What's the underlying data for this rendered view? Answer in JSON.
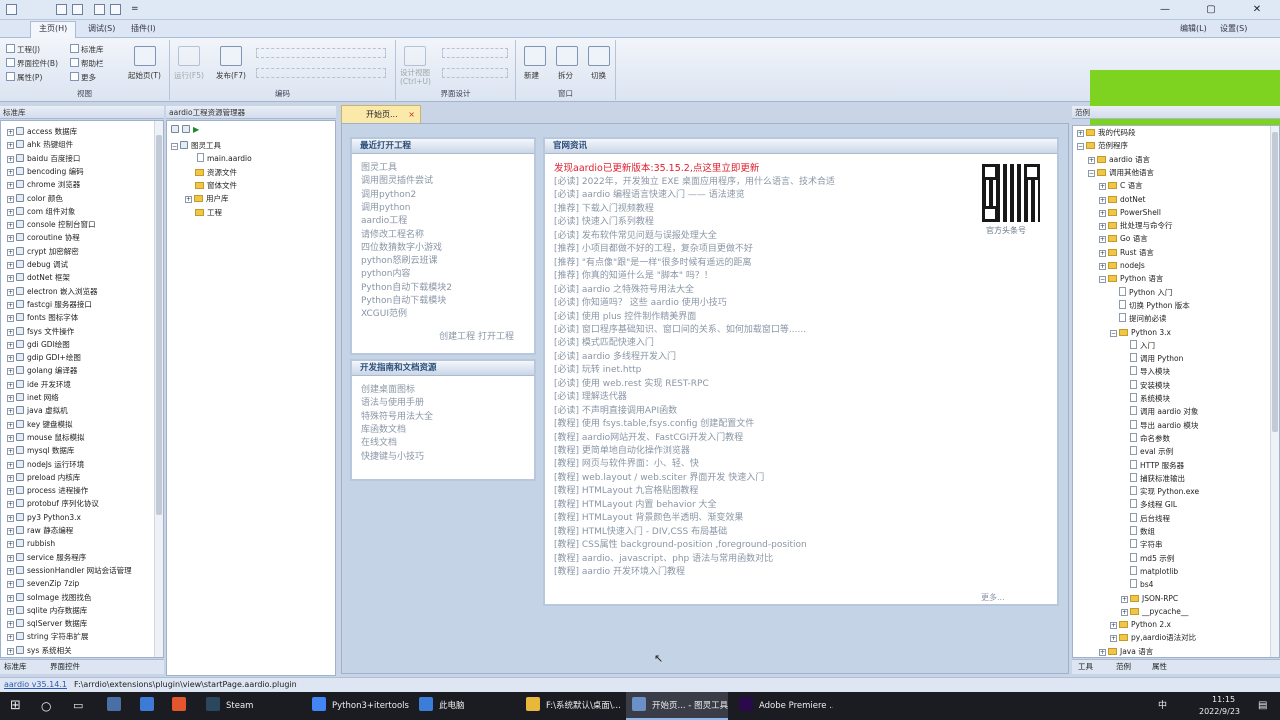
{
  "app": {
    "menu_tabs": [
      "主页(H)",
      "调试(S)",
      "插件(I)"
    ],
    "right_menu": [
      "编辑(L)",
      "设置(S)"
    ],
    "title_hint": "="
  },
  "ribbon": {
    "view_group": {
      "label": "视图",
      "items": [
        "工程(J)",
        "界面控件(B)",
        "属性(P)",
        "标准库",
        "帮助栏",
        "更多"
      ],
      "start_page": "起始页(T)"
    },
    "code_group": {
      "label": "编码",
      "run": "运行(F5)",
      "publish": "发布(F7)"
    },
    "ui_group": {
      "label": "界面设计",
      "design_view": "设计视图\n(Ctrl+U)"
    },
    "window_group": {
      "label": "窗口",
      "new": "新建",
      "split": "拆分",
      "switch": "切换"
    }
  },
  "left_panel": {
    "title": "标准库",
    "items": [
      "access 数据库",
      "ahk 热键组件",
      "baidu 百度接口",
      "bencoding 编码",
      "chrome 浏览器",
      "color 颜色",
      "com 组件对象",
      "console 控制台窗口",
      "coroutine 协程",
      "crypt 加密解密",
      "debug 调试",
      "dotNet 框架",
      "electron 嵌入浏览器",
      "fastcgi 服务器接口",
      "fonts 图标字体",
      "fsys 文件操作",
      "gdi GDI绘图",
      "gdip GDI+绘图",
      "golang 编译器",
      "ide 开发环境",
      "inet 网络",
      "java 虚拟机",
      "key 键盘模拟",
      "mouse 鼠标模拟",
      "mysql 数据库",
      "nodeJs 运行环境",
      "preload 内核库",
      "process 进程操作",
      "protobuf 序列化协议",
      "py3 Python3.x",
      "raw 静态编程",
      "rubbish",
      "service 服务程序",
      "sessionHandler 网站会话管理",
      "sevenZip 7zip",
      "soImage 找图找色",
      "sqlite 内存数据库",
      "sqlServer 数据库",
      "string 字符串扩展",
      "sys 系统相关"
    ],
    "bottom_tabs": [
      "标准库",
      "界面控件"
    ]
  },
  "project_panel": {
    "title": "aardio工程资源管理器",
    "items": [
      {
        "label": "图灵工具",
        "type": "root"
      },
      {
        "label": "main.aardio",
        "type": "file"
      },
      {
        "label": "资源文件",
        "type": "folder"
      },
      {
        "label": "窗体文件",
        "type": "folder"
      },
      {
        "label": "用户库",
        "type": "folder"
      },
      {
        "label": "工程",
        "type": "folder"
      }
    ]
  },
  "doc_tab": {
    "label": "开始页...",
    "close": "×"
  },
  "recent": {
    "title": "最近打开工程",
    "items": [
      "图灵工具",
      "调用图灵插件尝试",
      "调用python2",
      "调用python",
      "aardio工程",
      "请修改工程名称",
      "四位数猜数字小游戏",
      "python怒刷云班课",
      "python内容",
      "Python自动下载模块2",
      "Python自动下载模块",
      "XCGUI范例"
    ],
    "actions": "创建工程 打开工程"
  },
  "guides": {
    "title": "开发指南和文档资源",
    "items": [
      "创建桌面图标",
      "语法与使用手册",
      "特殊符号用法大全",
      "库函数文档",
      "在线文档",
      "快捷键与小技巧"
    ]
  },
  "news": {
    "title": "官网资讯",
    "headline": "发现aardio已更新版本:35.15.2,点这里立即更新",
    "qr_caption": "官方头条号",
    "more": "更多...",
    "items": [
      "[必读] 2022年，开发独立 EXE 桌面应用程序，用什么语言、技术合适",
      "[必读] aardio 编程语言快速入门 —— 语法速览",
      "[推荐] 下载入门视频教程",
      "[必读] 快速入门系列教程",
      "[必读] 发布软件常见问题与误报处理大全",
      "[推荐] 小项目都做不好的工程，复杂项目更做不好",
      "[推荐] \"有点像\"跟\"是一样\"很多时候有遥远的距离",
      "[推荐] 你真的知道什么是 \"脚本\" 吗？！",
      "[必读] aardio 之特殊符号用法大全",
      "[必读] 你知道吗？ 这些 aardio 使用小技巧",
      "[必读] 使用 plus 控件制作精美界面",
      "[必读] 窗口程序基础知识、窗口间的关系、如何加载窗口等......",
      "[必读] 模式匹配快速入门",
      "[必读] aardio 多线程开发入门",
      "[必读] 玩转 inet.http",
      "[必读] 使用 web.rest 实现 REST-RPC",
      "[必读] 理解迭代器",
      "[必读] 不声明直接调用API函数",
      "[教程] 使用 fsys.table,fsys.config 创建配置文件",
      "[教程] aardio网站开发、FastCGI开发入门教程",
      "[教程] 更简单地自动化操作浏览器",
      "[教程] 网页与软件界面：小、轻、快",
      "[教程] web.layout / web.sciter 界面开发 快速入门",
      "[教程] HTMLayout 九宫格贴图教程",
      "[教程] HTMLayout 内置 behavior 大全",
      "[教程] HTMLayout 背景颜色半透明、渐变效果",
      "[教程] HTML快速入门 - DIV,CSS 布局基础",
      "[教程] CSS属性 background-position ,foreground-position",
      "[教程] aardio、javascript、php 语法与常用函数对比",
      "[教程] aardio 开发环境入门教程"
    ]
  },
  "right_panel": {
    "title": "范例",
    "items": [
      {
        "label": "我的代码段",
        "level": 1,
        "type": "folder",
        "exp": "+"
      },
      {
        "label": "范例程序",
        "level": 1,
        "type": "folder",
        "exp": "-"
      },
      {
        "label": "aardio 语言",
        "level": 2,
        "type": "folder",
        "exp": "+"
      },
      {
        "label": "调用其他语言",
        "level": 2,
        "type": "folder",
        "exp": "-"
      },
      {
        "label": "C 语言",
        "level": 3,
        "type": "folder",
        "exp": "+"
      },
      {
        "label": "dotNet",
        "level": 3,
        "type": "folder",
        "exp": "+"
      },
      {
        "label": "PowerShell",
        "level": 3,
        "type": "folder",
        "exp": "+"
      },
      {
        "label": "批处理与命令行",
        "level": 3,
        "type": "folder",
        "exp": "+"
      },
      {
        "label": "Go 语言",
        "level": 3,
        "type": "folder",
        "exp": "+"
      },
      {
        "label": "Rust 语言",
        "level": 3,
        "type": "folder",
        "exp": "+"
      },
      {
        "label": "nodeJs",
        "level": 3,
        "type": "folder",
        "exp": "+"
      },
      {
        "label": "Python 语言",
        "level": 3,
        "type": "folder",
        "exp": "-"
      },
      {
        "label": "Python 入门",
        "level": 4,
        "type": "doc",
        "exp": ""
      },
      {
        "label": "切换 Python 版本",
        "level": 4,
        "type": "doc",
        "exp": ""
      },
      {
        "label": "提问前必读",
        "level": 4,
        "type": "doc",
        "exp": ""
      },
      {
        "label": "Python 3.x",
        "level": 4,
        "type": "folder",
        "exp": "-"
      },
      {
        "label": "入门",
        "level": 5,
        "type": "doc",
        "exp": ""
      },
      {
        "label": "调用 Python",
        "level": 5,
        "type": "doc",
        "exp": ""
      },
      {
        "label": "导入模块",
        "level": 5,
        "type": "doc",
        "exp": ""
      },
      {
        "label": "安装模块",
        "level": 5,
        "type": "doc",
        "exp": ""
      },
      {
        "label": "系统模块",
        "level": 5,
        "type": "doc",
        "exp": ""
      },
      {
        "label": "调用 aardio 对象",
        "level": 5,
        "type": "doc",
        "exp": ""
      },
      {
        "label": "导出 aardio 模块",
        "level": 5,
        "type": "doc",
        "exp": ""
      },
      {
        "label": "命名参数",
        "level": 5,
        "type": "doc",
        "exp": ""
      },
      {
        "label": "eval 示例",
        "level": 5,
        "type": "doc",
        "exp": ""
      },
      {
        "label": "HTTP 服务器",
        "level": 5,
        "type": "doc",
        "exp": ""
      },
      {
        "label": "捕获标准输出",
        "level": 5,
        "type": "doc",
        "exp": ""
      },
      {
        "label": "实现 Python.exe",
        "level": 5,
        "type": "doc",
        "exp": ""
      },
      {
        "label": "多线程 GIL",
        "level": 5,
        "type": "doc",
        "exp": ""
      },
      {
        "label": "后台线程",
        "level": 5,
        "type": "doc",
        "exp": ""
      },
      {
        "label": "数组",
        "level": 5,
        "type": "doc",
        "exp": ""
      },
      {
        "label": "字符串",
        "level": 5,
        "type": "doc",
        "exp": ""
      },
      {
        "label": "md5 示例",
        "level": 5,
        "type": "doc",
        "exp": ""
      },
      {
        "label": "matplotlib",
        "level": 5,
        "type": "doc",
        "exp": ""
      },
      {
        "label": "bs4",
        "level": 5,
        "type": "doc",
        "exp": ""
      },
      {
        "label": "JSON-RPC",
        "level": 5,
        "type": "folder",
        "exp": "+"
      },
      {
        "label": "__pycache__",
        "level": 5,
        "type": "folder",
        "exp": "+"
      },
      {
        "label": "Python 2.x",
        "level": 4,
        "type": "folder",
        "exp": "+"
      },
      {
        "label": "py,aardio语法对比",
        "level": 4,
        "type": "folder",
        "exp": "+"
      },
      {
        "label": "Java 语言",
        "level": 3,
        "type": "folder",
        "exp": "+"
      }
    ],
    "bottom_tabs": [
      "工具",
      "范例",
      "属性"
    ]
  },
  "statusbar": {
    "version": "aardio v35.14.1",
    "path": "F:\\arrdio\\extensions\\plugin\\view\\startPage.aardio.plugin"
  },
  "taskbar": {
    "items": [
      {
        "label": "Steam",
        "color": "#2a475e"
      },
      {
        "label": "Python3+itertools...",
        "color": "#4285f4"
      },
      {
        "label": "此电脑",
        "color": "#3b7dd8"
      },
      {
        "label": "F:\\系统默认\\桌面\\...",
        "color": "#e8b83a"
      },
      {
        "label": "开始页... - 图灵工具",
        "color": "#6b8fc7"
      },
      {
        "label": "Adobe Premiere ...",
        "color": "#2a0a4a"
      }
    ],
    "tray_lang": "中",
    "time": "11:15",
    "date": "2022/9/23"
  },
  "colors": {
    "accent_green": "#7ed321",
    "headline_red": "#e0202f",
    "card_title": "#2a4d7a"
  }
}
